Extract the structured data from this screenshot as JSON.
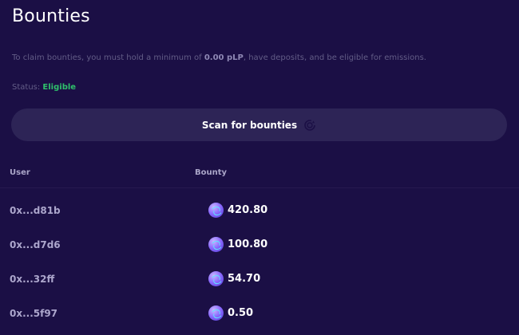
{
  "header": {
    "title": "Bounties"
  },
  "info": {
    "prefix": "To claim bounties, you must hold a minimum of ",
    "min_amount": "0.00 pLP",
    "suffix": ", have deposits, and be eligible for emissions."
  },
  "status": {
    "label": "Status:",
    "value": "Eligible",
    "value_color": "#2fc06b"
  },
  "scan_button": {
    "label": "Scan for bounties",
    "icon": "refresh-icon"
  },
  "table": {
    "columns": [
      "User",
      "Bounty"
    ],
    "rows": [
      {
        "user": "0x...d81b",
        "bounty": "420.80",
        "token_icon": "token-icon"
      },
      {
        "user": "0x...d7d6",
        "bounty": "100.80",
        "token_icon": "token-icon"
      },
      {
        "user": "0x...32ff",
        "bounty": "54.70",
        "token_icon": "token-icon"
      },
      {
        "user": "0x...5f97",
        "bounty": "0.50",
        "token_icon": "token-icon"
      }
    ]
  },
  "colors": {
    "background": "#1b0f45",
    "button": "#2d2456",
    "accent": "#2fc06b"
  }
}
